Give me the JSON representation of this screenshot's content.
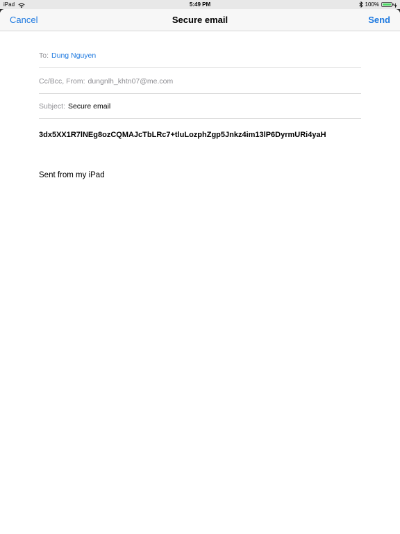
{
  "status_bar": {
    "carrier": "iPad",
    "time": "5:49 PM",
    "battery_percent_label": "100%",
    "battery_level": 1.0,
    "icons": [
      "wifi-icon",
      "bluetooth-icon",
      "battery-icon",
      "charging-icon"
    ]
  },
  "nav": {
    "cancel_label": "Cancel",
    "title": "Secure email",
    "send_label": "Send"
  },
  "fields": {
    "to_label": "To:",
    "to_value": "Dung Nguyen",
    "ccbcc_label": "Cc/Bcc, From:",
    "from_value": "dungnlh_khtn07@me.com",
    "subject_label": "Subject:",
    "subject_value": "Secure email"
  },
  "body": {
    "token": "3dx5XX1R7lNEg8ozCQMAJcTbLRc7+tluLozphZgp5Jnkz4im13lP6DyrmURi4yaH",
    "signature": "Sent from my iPad"
  },
  "colors": {
    "accent": "#1f7ae0",
    "muted": "#8e8e93",
    "battery_fill": "#4cd964"
  }
}
